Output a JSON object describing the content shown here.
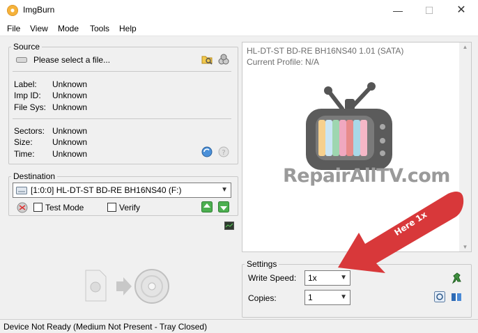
{
  "window": {
    "title": "ImgBurn",
    "min": "—",
    "max": "☐",
    "close": "✕"
  },
  "menu": [
    "File",
    "View",
    "Mode",
    "Tools",
    "Help"
  ],
  "source": {
    "legend": "Source",
    "placeholder": "Please select a file...",
    "info": [
      {
        "k": "Label:",
        "v": "Unknown"
      },
      {
        "k": "Imp ID:",
        "v": "Unknown"
      },
      {
        "k": "File Sys:",
        "v": "Unknown"
      }
    ],
    "info2": [
      {
        "k": "Sectors:",
        "v": "Unknown"
      },
      {
        "k": "Size:",
        "v": "Unknown"
      },
      {
        "k": "Time:",
        "v": "Unknown"
      }
    ]
  },
  "destination": {
    "legend": "Destination",
    "drive": "[1:0:0] HL-DT-ST BD-RE  BH16NS40 (F:)",
    "test_mode": "Test Mode",
    "verify": "Verify"
  },
  "device": {
    "line1": "HL-DT-ST BD-RE  BH16NS40 1.01 (SATA)",
    "line2": "Current Profile: N/A"
  },
  "watermark": {
    "text": "RepairAllTV.com"
  },
  "annotation": {
    "text": "Here 1x"
  },
  "settings": {
    "legend": "Settings",
    "write_speed_label": "Write Speed:",
    "write_speed_value": "1x",
    "copies_label": "Copies:",
    "copies_value": "1"
  },
  "status": "Device Not Ready (Medium Not Present - Tray Closed)"
}
